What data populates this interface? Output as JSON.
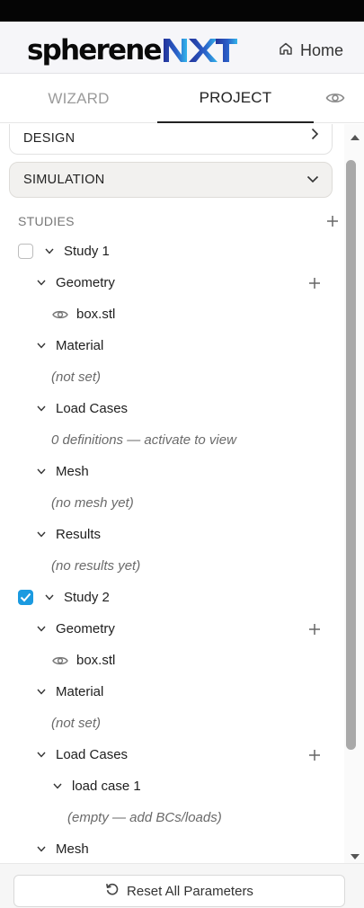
{
  "brand": {
    "name_part1": "spherene",
    "name_part2": "NXT"
  },
  "header": {
    "home_label": "Home"
  },
  "tabs": [
    {
      "label": "WIZARD",
      "active": false
    },
    {
      "label": "PROJECT",
      "active": true
    }
  ],
  "cards": {
    "design": "DESIGN",
    "simulation": "SIMULATION"
  },
  "studies_header": "STUDIES",
  "study1": {
    "name": "Study 1",
    "checked": false,
    "geometry": "Geometry",
    "file": "box.stl",
    "material": "Material",
    "material_note": "(not set)",
    "load_cases": "Load Cases",
    "load_cases_note": "0 definitions — activate to view",
    "mesh": "Mesh",
    "mesh_note": "(no mesh yet)",
    "results": "Results",
    "results_note": "(no results yet)"
  },
  "study2": {
    "name": "Study 2",
    "checked": true,
    "geometry": "Geometry",
    "file": "box.stl",
    "material": "Material",
    "material_note": "(not set)",
    "load_cases": "Load Cases",
    "load_case_1": "load case 1",
    "load_case_1_note": "(empty — add BCs/loads)",
    "mesh": "Mesh"
  },
  "footer": {
    "reset_label": "Reset All Parameters"
  },
  "colors": {
    "accent": "#1b9ae0",
    "logo_blue_dark": "#24339a",
    "logo_blue_light": "#33b5ea"
  }
}
